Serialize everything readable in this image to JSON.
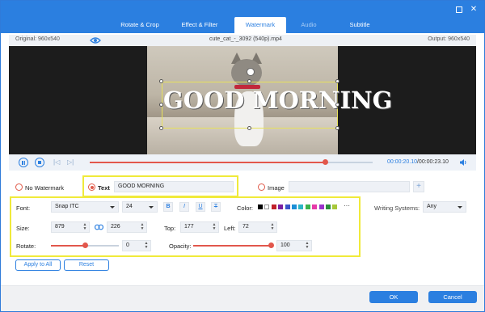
{
  "tabs": [
    {
      "label": "Rotate & Crop"
    },
    {
      "label": "Effect & Filter"
    },
    {
      "label": "Watermark"
    },
    {
      "label": "Audio"
    },
    {
      "label": "Subtitle"
    }
  ],
  "info": {
    "original": "Original: 960x540",
    "filename": "cute_cat_-_3092 (540p).mp4",
    "output": "Output: 960x540"
  },
  "preview": {
    "watermark_text": "GOOD MORNING"
  },
  "playback": {
    "current_time": "00:00:20.10",
    "total_time": "/00:00:23.10",
    "progress": 0.83
  },
  "watermark": {
    "no_watermark_label": "No Watermark",
    "text_label": "Text",
    "text_value": "GOOD MORNING",
    "image_label": "Image",
    "add_icon": "plus-icon",
    "selected": "text"
  },
  "options": {
    "font_label": "Font:",
    "font_value": "Snap ITC",
    "size_value_font": "24",
    "bold": "B",
    "italic": "I",
    "underline": "U",
    "strike": "T",
    "color_label": "Color:",
    "colors": [
      "#000000",
      "#ffffff",
      "#c0202a",
      "#7a1fa0",
      "#3a55c7",
      "#1b8fd6",
      "#2bb6c4",
      "#3bb34a",
      "#e63aa8",
      "#9a32c9",
      "#2a8f3a",
      "#a8c83a"
    ],
    "more_colors": "···",
    "writing_label": "Writing Systems:",
    "writing_value": "Any",
    "size_label": "Size:",
    "width": "879",
    "height": "226",
    "top_label": "Top:",
    "top_value": "177",
    "left_label": "Left:",
    "left_value": "72",
    "rotate_label": "Rotate:",
    "rotate_value": "0",
    "rotate_level": 0.5,
    "opacity_label": "Opacity:",
    "opacity_value": "100",
    "opacity_level": 1.0
  },
  "actions": {
    "apply_all": "Apply to All",
    "reset": "Reset"
  },
  "footer": {
    "ok": "OK",
    "cancel": "Cancel"
  },
  "accent": "#2b7fe0",
  "highlight": "#f0ea3a"
}
